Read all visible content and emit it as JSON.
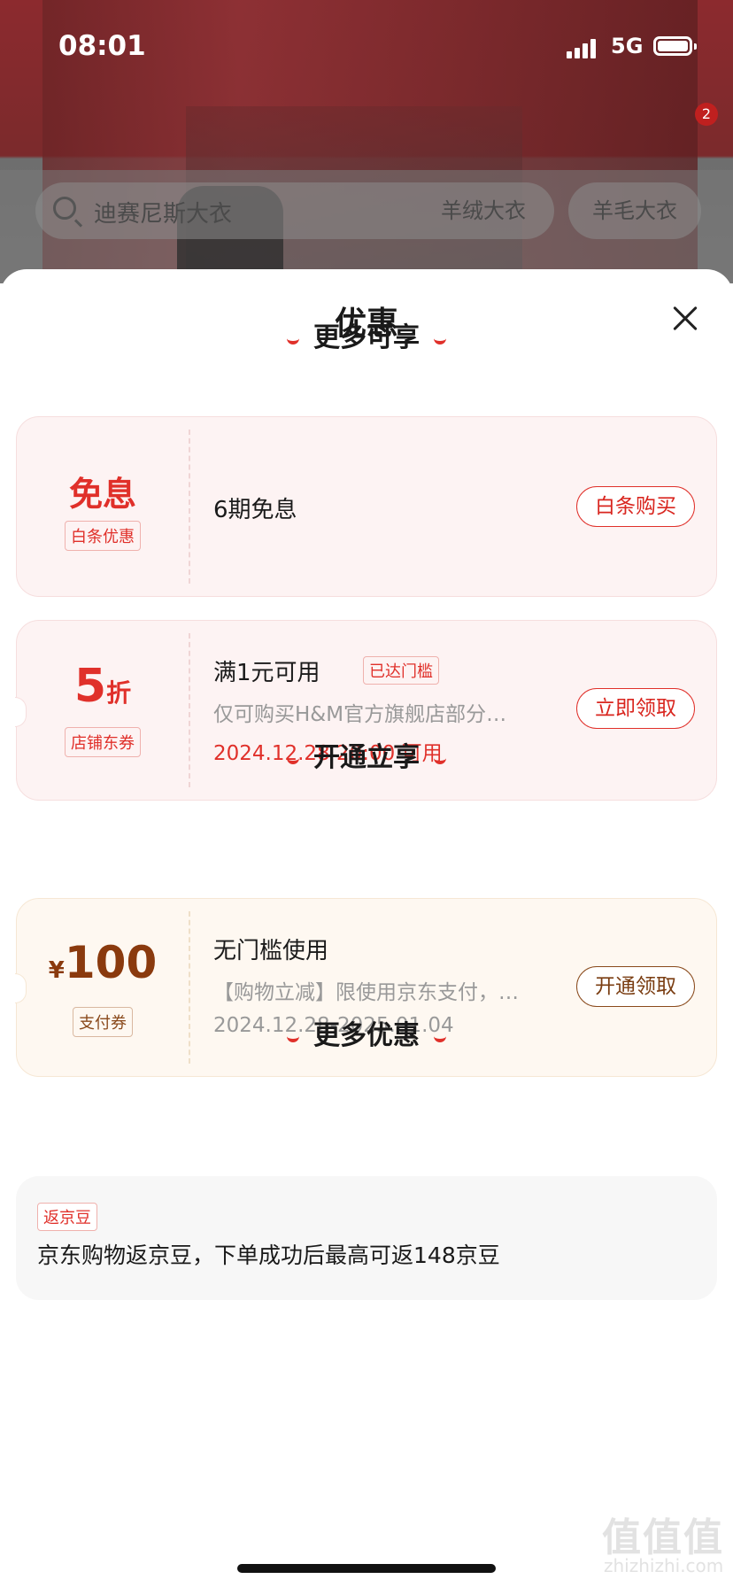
{
  "status": {
    "time": "08:01",
    "network": "5G"
  },
  "background": {
    "cart_badge": "2",
    "search_placeholder": "迪赛尼斯大衣",
    "tags": [
      "羊绒大衣",
      "羊毛大衣"
    ]
  },
  "sheet": {
    "title": "优惠",
    "sections": {
      "more_available": "更多可享",
      "open_enjoy": "开通立享",
      "more_offers": "更多优惠"
    },
    "baitiao": {
      "main": "免息",
      "tag": "白条优惠",
      "desc": "6期免息",
      "button": "白条购买"
    },
    "store_coupon": {
      "value": "5",
      "unit": "折",
      "tag": "店铺东券",
      "title": "满1元可用",
      "badge": "已达门槛",
      "desc": "仅可购买H&M官方旗舰店部分…",
      "time": "2024.12.28 20:00 可用",
      "button": "立即领取"
    },
    "pay_coupon": {
      "currency": "¥",
      "value": "100",
      "tag": "支付券",
      "title": "无门槛使用",
      "desc": "【购物立减】限使用京东支付，…",
      "time": "2024.12.28-2025.01.04",
      "button": "开通领取"
    },
    "jingdou": {
      "tag": "返京豆",
      "text": "京东购物返京豆，下单成功后最高可返148京豆"
    }
  },
  "watermark": {
    "logo": "值值值",
    "domain": "zhizhizhi.com"
  },
  "colors": {
    "accent_red": "#e0302a",
    "accent_brown": "#8a4a1c"
  }
}
